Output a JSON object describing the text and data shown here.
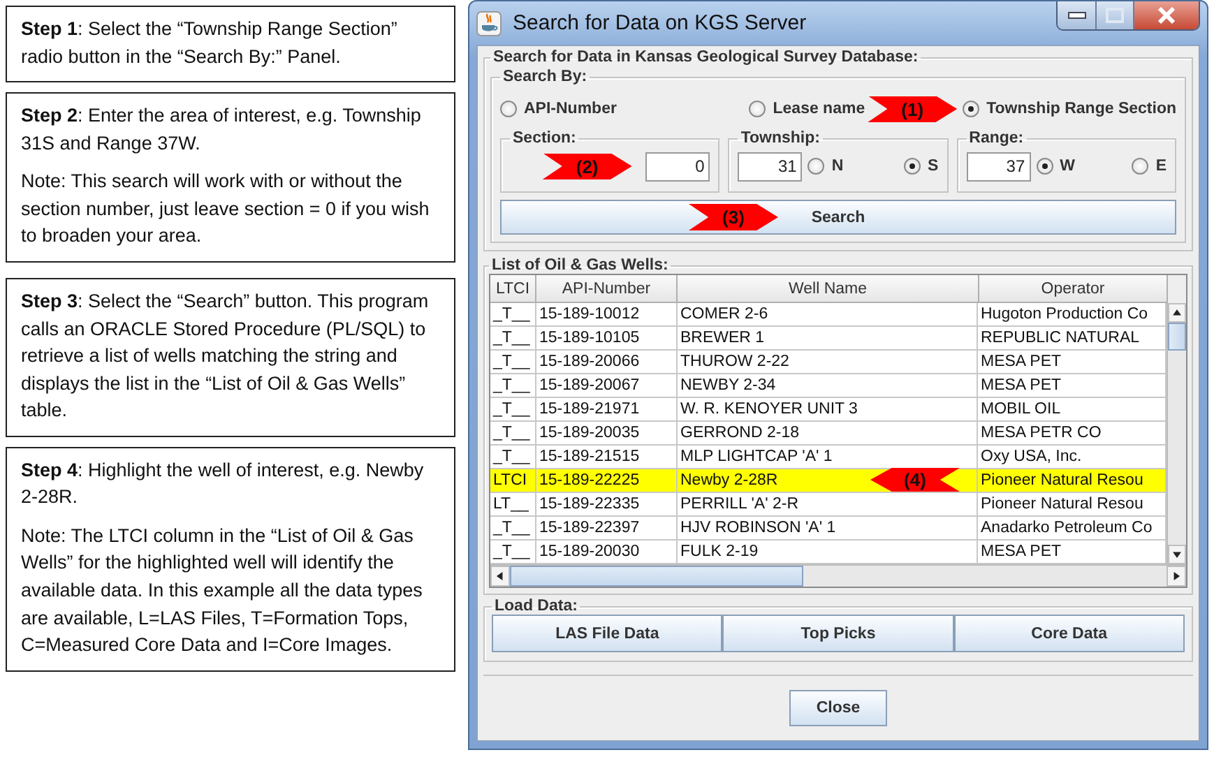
{
  "instructions": [
    {
      "paragraphs": [
        "**Step 1**: Select the “Township Range Section” radio button in the “Search By:” Panel."
      ]
    },
    {
      "paragraphs": [
        "**Step 2**: Enter the area of interest, e.g. Township 31S and Range 37W.",
        "Note: This search will work with or without the section number, just leave section = 0 if you wish to broaden your area."
      ]
    },
    {
      "paragraphs": [
        "**Step 3**: Select the “Search” button. This program calls an ORACLE Stored Procedure (PL/SQL) to retrieve a list of wells matching the string and displays the list in the “List of Oil & Gas Wells” table."
      ]
    },
    {
      "paragraphs": [
        "**Step 4**: Highlight the well of interest, e.g. Newby 2-28R.",
        "Note: The LTCI column in the “List of Oil & Gas Wells” for the highlighted well will identify the available data. In this example all the data types are available, L=LAS Files, T=Formation Tops, C=Measured Core Data and I=Core Images."
      ]
    }
  ],
  "window": {
    "title": "Search for Data on KGS Server",
    "search_panel": {
      "title": "Search for Data in Kansas Geological Survey Database:",
      "search_by": {
        "title": "Search By:",
        "options": [
          {
            "label": "API-Number",
            "selected": false
          },
          {
            "label": "Lease name",
            "selected": false
          },
          {
            "label": "Township Range Section",
            "selected": true
          }
        ],
        "callout": {
          "label": "(1)",
          "kind": "right"
        }
      },
      "section": {
        "title": "Section:",
        "value": "0",
        "callout": {
          "label": "(2)",
          "kind": "right"
        }
      },
      "township": {
        "title": "Township:",
        "value": "31",
        "directions": [
          {
            "label": "N",
            "selected": false
          },
          {
            "label": "S",
            "selected": true
          }
        ]
      },
      "range": {
        "title": "Range:",
        "value": "37",
        "directions": [
          {
            "label": "W",
            "selected": true
          },
          {
            "label": "E",
            "selected": false
          }
        ]
      },
      "search_button": {
        "label": "Search",
        "callout": {
          "label": "(3)",
          "kind": "right"
        }
      }
    },
    "wells": {
      "title": "List of Oil & Gas Wells:",
      "columns": [
        "LTCI",
        "API-Number",
        "Well Name",
        "Operator"
      ],
      "rows": [
        {
          "cells": [
            "_T__",
            "15-189-10012",
            "COMER 2-6",
            "Hugoton Production Co"
          ],
          "selected": false
        },
        {
          "cells": [
            "_T__",
            "15-189-10105",
            "BREWER 1",
            "REPUBLIC NATURAL"
          ],
          "selected": false
        },
        {
          "cells": [
            "_T__",
            "15-189-20066",
            "THUROW 2-22",
            "MESA PET"
          ],
          "selected": false
        },
        {
          "cells": [
            "_T__",
            "15-189-20067",
            "NEWBY 2-34",
            "MESA PET"
          ],
          "selected": false
        },
        {
          "cells": [
            "_T__",
            "15-189-21971",
            "W. R. KENOYER UNIT 3",
            "MOBIL OIL"
          ],
          "selected": false
        },
        {
          "cells": [
            "_T__",
            "15-189-20035",
            "GERROND 2-18",
            "MESA PETR CO"
          ],
          "selected": false
        },
        {
          "cells": [
            "_T__",
            "15-189-21515",
            "MLP LIGHTCAP 'A' 1",
            "Oxy USA, Inc."
          ],
          "selected": false
        },
        {
          "cells": [
            "LTCI",
            "15-189-22225",
            "Newby 2-28R",
            "Pioneer Natural Resou"
          ],
          "selected": true,
          "callout": {
            "label": "(4)",
            "kind": "left"
          }
        },
        {
          "cells": [
            "LT__",
            "15-189-22335",
            "PERRILL 'A' 2-R",
            "Pioneer Natural Resou"
          ],
          "selected": false
        },
        {
          "cells": [
            "_T__",
            "15-189-22397",
            "HJV ROBINSON 'A' 1",
            "Anadarko Petroleum Co"
          ],
          "selected": false
        },
        {
          "cells": [
            "_T__",
            "15-189-20030",
            "FULK 2-19",
            "MESA PET"
          ],
          "selected": false
        }
      ]
    },
    "load_data": {
      "title": "Load Data:",
      "buttons": [
        "LAS File Data",
        "Top Picks",
        "Core Data"
      ]
    },
    "close_button": "Close"
  }
}
